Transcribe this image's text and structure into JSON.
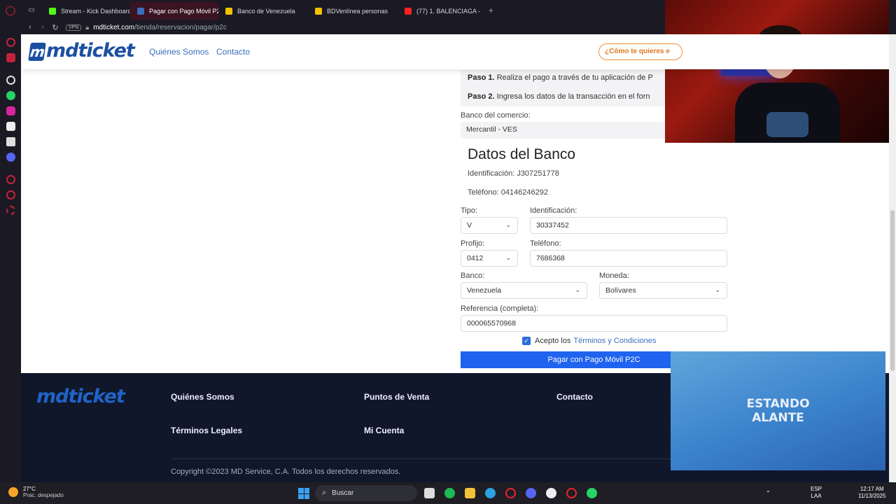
{
  "browser": {
    "tabs": [
      {
        "label": "Stream - Kick Dashboard",
        "color": "#53fc18",
        "active": false
      },
      {
        "label": "Pagar con Pago Móvil P2",
        "color": "#3a6fbe",
        "active": true
      },
      {
        "label": "Banco de Venezuela",
        "color": "#f2c200",
        "active": false
      },
      {
        "label": "BDVenlínea personas",
        "color": "#f2c200",
        "active": false
      },
      {
        "label": "(77) 1. BALENCIAGA -",
        "color": "#ff2020",
        "active": false
      }
    ],
    "new_tab": "+",
    "url_host": "mdticket.com",
    "url_path": "/tienda/reservacion/pagar/p2c",
    "vpn": "VPN"
  },
  "header": {
    "logo": "mdticket",
    "nav": [
      "Quiénes Somos",
      "Contacto"
    ],
    "help_button": "¿Cómo te quieres e"
  },
  "steps": {
    "step1_label": "Paso 1.",
    "step1_text": "Realiza el pago a través de tu aplicación de P",
    "step2_label": "Paso 2.",
    "step2_text": "Ingresa los datos de la transacción en el forn"
  },
  "commerce_bank": {
    "label": "Banco del comercio:",
    "value": "Mercantil - VES"
  },
  "bank_data": {
    "title": "Datos del Banco",
    "identification": "Identificación: J307251778",
    "phone": "Teléfono: 04146246292"
  },
  "form": {
    "tipo_label": "Tipo:",
    "tipo_value": "V",
    "id_label": "Identificación:",
    "id_value": "30337452",
    "prefijo_label": "Profijo:",
    "prefijo_value": "0412",
    "telefono_label": "Teléfono:",
    "telefono_value": "7686368",
    "banco_label": "Banco:",
    "banco_value": "Venezuela",
    "moneda_label": "Moneda:",
    "moneda_value": "Bolívares",
    "ref_label": "Referencia (completa):",
    "ref_value": "000065570968",
    "accept_prefix": "Acepto los",
    "accept_link": "Términos y Condiciones",
    "submit": "Pagar con Pago Móvil P2C",
    "checkbox_mark": "✓"
  },
  "footer": {
    "logo": "mdticket",
    "links": {
      "quienes": "Quiénes Somos",
      "puntos": "Puntos de Venta",
      "contacto": "Contacto",
      "terminos": "Términos Legales",
      "cuenta": "Mi Cuenta"
    },
    "copyright": "Copyright ©2023 MD Service, C.A. Todos los derechos reservados."
  },
  "overlay": {
    "alert_line1": "ESTANDO",
    "alert_line2": "ALANTE"
  },
  "taskbar": {
    "temp": "27°C",
    "weather": "Prac. despejado",
    "search": "Buscar",
    "lang1": "ESP",
    "lang2": "LAA",
    "time": "12:17 AM",
    "date": "11/13/2025"
  }
}
